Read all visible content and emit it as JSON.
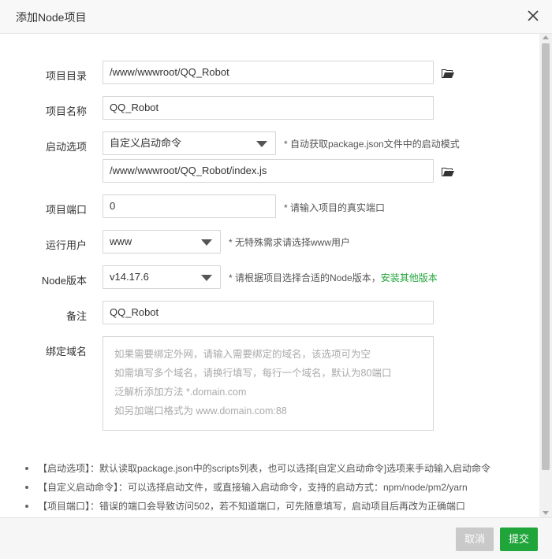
{
  "dialog": {
    "title": "添加Node项目"
  },
  "form": {
    "project_dir": {
      "label": "项目目录",
      "value": "/www/wwwroot/QQ_Robot"
    },
    "project_name": {
      "label": "项目名称",
      "value": "QQ_Robot"
    },
    "start_option": {
      "label": "启动选项",
      "selected": "自定义启动命令",
      "hint": "* 自动获取package.json文件中的启动模式",
      "file_value": "/www/wwwroot/QQ_Robot/index.js"
    },
    "project_port": {
      "label": "项目端口",
      "value": "0",
      "hint": "* 请输入项目的真实端口"
    },
    "run_user": {
      "label": "运行用户",
      "selected": "www",
      "hint": "* 无特殊需求请选择www用户"
    },
    "node_version": {
      "label": "Node版本",
      "selected": "v14.17.6",
      "hint": "* 请根据项目选择合适的Node版本，",
      "link": "安装其他版本"
    },
    "remark": {
      "label": "备注",
      "value": "QQ_Robot"
    },
    "domain": {
      "label": "绑定域名",
      "placeholder_lines": [
        "如果需要绑定外网，请输入需要绑定的域名，该选项可为空",
        "如需填写多个域名，请换行填写，每行一个域名，默认为80端口",
        "泛解析添加方法 *.domain.com",
        "如另加端口格式为 www.domain.com:88"
      ]
    }
  },
  "tips": [
    "【启动选项】：默认读取package.json中的scripts列表，也可以选择[自定义启动命令]选项来手动输入启动命令",
    "【自定义启动命令】：可以选择启动文件，或直接输入启动命令，支持的启动方式：npm/node/pm2/yarn",
    "【项目端口】：错误的端口会导致访问502，若不知道端口，可先随意填写，启动项目后再改为正确端口"
  ],
  "footer": {
    "cancel_label": "取消",
    "submit_label": "提交"
  },
  "colors": {
    "accent": "#20a53a",
    "cancel": "#c9c9c9"
  },
  "icons": {
    "close": "close-icon",
    "folder": "folder-open-icon",
    "dropdown": "chevron-down-icon"
  }
}
